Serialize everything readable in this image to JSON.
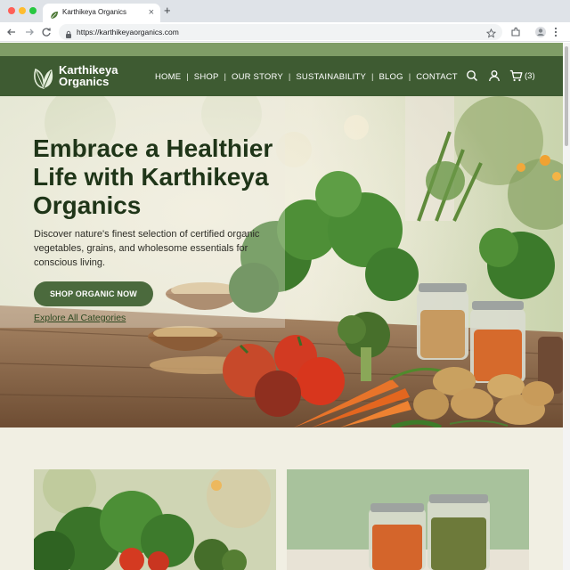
{
  "browser": {
    "tab_title": "Karthikeya Organics",
    "tab_close": "×",
    "new_tab": "+",
    "url": "https://karthikeyaorganics.com"
  },
  "site": {
    "logo_line1": "Karthikeya",
    "logo_line2": "Organics",
    "nav": [
      "HOME",
      "SHOP",
      "OUR STORY",
      "SUSTAINABILITY",
      "BLOG",
      "CONTACT"
    ],
    "nav_separator": "|",
    "cart_count": "(3)"
  },
  "hero": {
    "title": "Embrace a Healthier Life with Karthikeya Organics",
    "subtitle": "Discover nature's finest selection of certified organic vegetables, grains, and wholesome essentials for conscious living.",
    "cta_label": "SHOP ORGANIC NOW",
    "secondary_link": "Explore All Categories"
  },
  "colors": {
    "header_green": "#3e5b32",
    "accent_strip": "#7f9d67",
    "cta_green": "#4b6a3d",
    "title_green": "#1f3518",
    "page_cream": "#f1efe3"
  },
  "icons": [
    "leaf-logo-icon",
    "search-icon",
    "account-icon",
    "cart-icon",
    "back-icon",
    "forward-icon",
    "reload-icon",
    "lock-icon",
    "bookmark-star-icon",
    "extensions-icon",
    "profile-icon",
    "menu-kebab-icon"
  ]
}
